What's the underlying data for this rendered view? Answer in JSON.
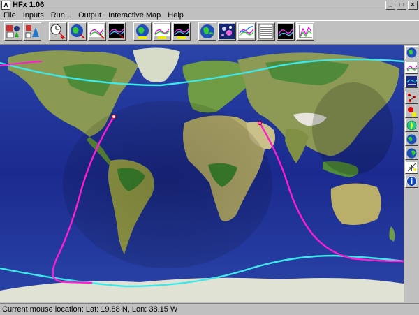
{
  "window": {
    "title": "HFx 1.06",
    "controls": [
      "_",
      "□",
      "×"
    ]
  },
  "menu": [
    "File",
    "Inputs",
    "Run...",
    "Output",
    "Interactive Map",
    "Help"
  ],
  "toolbar": {
    "buttons": [
      {
        "name": "station-input-icon"
      },
      {
        "name": "transmitter-params-icon"
      },
      {
        "name": "time-run-icon"
      },
      {
        "name": "globe-run-icon"
      },
      {
        "name": "graph-run-icon"
      },
      {
        "name": "night-map-run-icon"
      },
      {
        "name": "globe-output-icon"
      },
      {
        "name": "graph-output-icon"
      },
      {
        "name": "night-graph-output-icon"
      },
      {
        "name": "globe-map-icon"
      },
      {
        "name": "satellite-map-icon"
      },
      {
        "name": "propagation-chart-icon"
      },
      {
        "name": "text-report-icon"
      },
      {
        "name": "area-coverage-icon"
      },
      {
        "name": "frequency-chart-icon"
      }
    ]
  },
  "sidebar": {
    "buttons": [
      {
        "name": "globe-view-icon"
      },
      {
        "name": "muf-chart-icon"
      },
      {
        "name": "coverage-map-icon"
      },
      {
        "name": "path-points-icon"
      },
      {
        "name": "red-marker-icon"
      },
      {
        "name": "compass-icon"
      },
      {
        "name": "globe-west-icon"
      },
      {
        "name": "globe-east-icon"
      },
      {
        "name": "antenna-icon"
      },
      {
        "name": "info-icon"
      }
    ]
  },
  "colors": {
    "path": "#ff1ecf",
    "beam": "#3fe8e8",
    "ocean": "#1a2a8a"
  },
  "status": {
    "text": "Current mouse location:  Lat: 19.88 N,  Lon: 38.15 W"
  }
}
